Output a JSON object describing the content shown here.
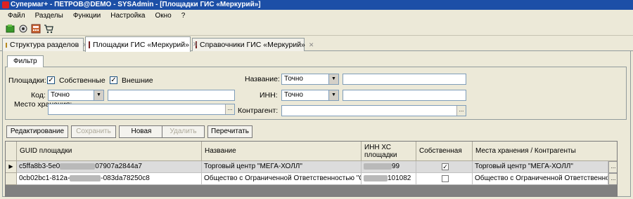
{
  "window": {
    "title": "Супермаг+ - ПЕТРОВ@DEMO - SYSAdmin  - [Площадки ГИС «Меркурий»]"
  },
  "menu": [
    "Файл",
    "Разделы",
    "Функции",
    "Настройка",
    "Окно",
    "?"
  ],
  "toolbar": [
    "open-icon",
    "settings-icon",
    "calculator-icon",
    "cart-icon"
  ],
  "tabs": [
    {
      "label": "Структура разделов",
      "icon": "tree-icon"
    },
    {
      "label": "Площадки ГИС «Меркурий»",
      "icon": "calendar-icon",
      "active": true
    },
    {
      "label": "Справочники ГИС «Меркурий»",
      "icon": "book-icon"
    }
  ],
  "filter": {
    "tab_label": "Фильтр",
    "sites_label": "Площадки:",
    "own_label": "Собственные",
    "own_checked": true,
    "external_label": "Внешние",
    "external_checked": true,
    "code_label": "Код:",
    "code_mode": "Точно",
    "code_value": "",
    "storage_label": "Место хранения:",
    "storage_value": "",
    "name_label": "Название:",
    "name_mode": "Точно",
    "name_value": "",
    "inn_label": "ИНН:",
    "inn_mode": "Точно",
    "inn_value": "",
    "counterparty_label": "Контрагент:",
    "counterparty_value": ""
  },
  "actions": [
    {
      "label": "Редактирование",
      "enabled": true
    },
    {
      "label": "Сохранить",
      "enabled": false
    },
    {
      "label": "Новая",
      "enabled": true
    },
    {
      "label": "Удалить",
      "enabled": false
    },
    {
      "label": "Перечитать",
      "enabled": true
    }
  ],
  "grid": {
    "columns": [
      "GUID площадки",
      "Название",
      "ИНН ХС площадки",
      "Собственная",
      "Места хранения / Контрагенты"
    ],
    "rows": [
      {
        "guid_start": "c5ffa8b3-5e0",
        "guid_end": "07907a2844a7",
        "name": "Торговый центр \"МЕГА-ХОЛЛ\"",
        "inn_visible": "99",
        "own": true,
        "storage": "Торговый центр \"МЕГА-ХОЛЛ\"",
        "selected": true
      },
      {
        "guid_start": "0cb02bc1-812a-",
        "guid_end": "-083da78250c8",
        "name": "Общество с Ограниченной Ответственностью \"Серв...",
        "inn_visible": "101082",
        "own": false,
        "storage": "Общество с Ограниченной Ответственность...",
        "selected": false
      }
    ]
  }
}
